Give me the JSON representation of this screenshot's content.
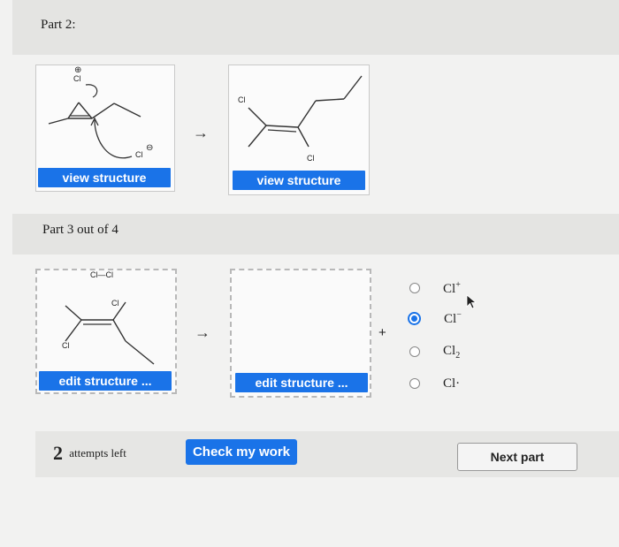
{
  "part2": {
    "title": "Part 2:",
    "view_structure_1": "view structure",
    "view_structure_2": "view structure",
    "arrow": "→",
    "labels": {
      "cl_plus": "Cl",
      "plus_charge": "⊕",
      "cl_minus": "Cl",
      "minus_charge": "⊖",
      "cl_top": "Cl",
      "cl_bottom": "Cl"
    }
  },
  "part3": {
    "title": "Part 3 out of 4",
    "reactant_label": "Cl—Cl",
    "cl_a": "Cl",
    "cl_b": "Cl",
    "edit_structure_1": "edit structure ...",
    "edit_structure_2": "edit structure ...",
    "arrow": "→",
    "plus": "+"
  },
  "options": [
    {
      "base": "Cl",
      "sup": "+",
      "sub": "",
      "selected": false
    },
    {
      "base": "Cl",
      "sup": "−",
      "sub": "",
      "selected": true
    },
    {
      "base": "Cl",
      "sup": "",
      "sub": "2",
      "selected": false
    },
    {
      "base": "Cl·",
      "sup": "",
      "sub": "",
      "selected": false
    }
  ],
  "footer": {
    "attempts_number": "2",
    "attempts_text": "attempts left",
    "check_label": "Check my work",
    "next_label": "Next part"
  },
  "colors": {
    "accent": "#1a73e8"
  }
}
